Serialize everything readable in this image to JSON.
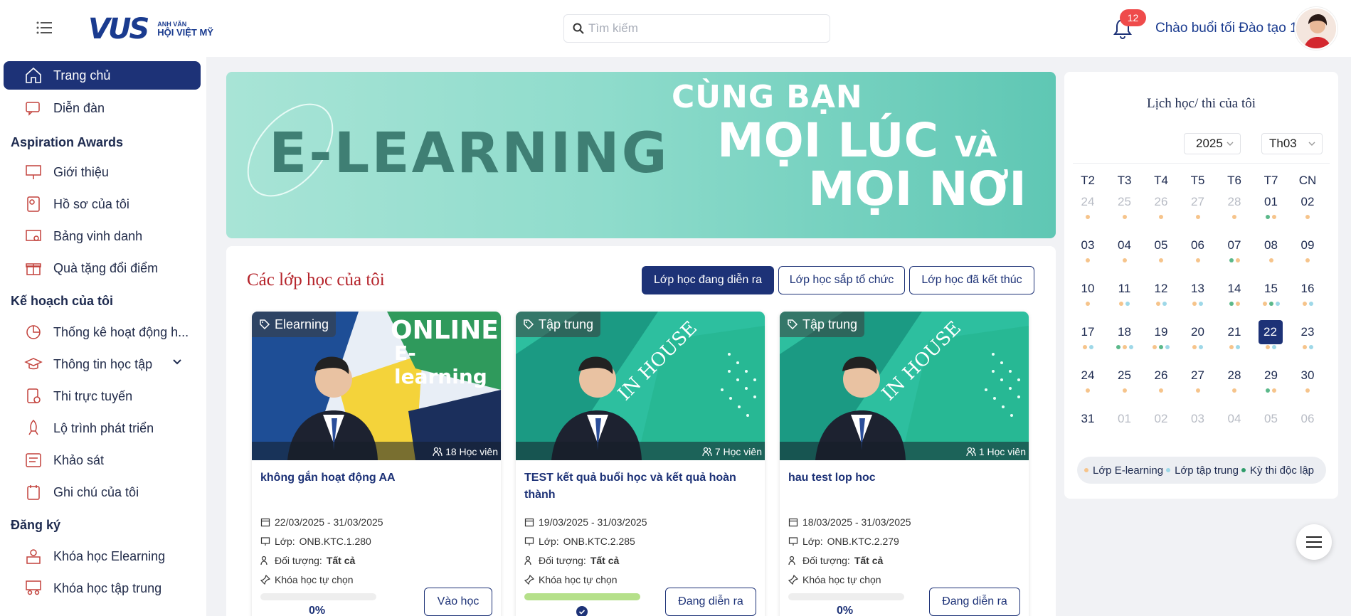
{
  "header": {
    "logo_mark": "VUS",
    "logo_sub": "ANH VĂN",
    "logo_main": "HỘI VIỆT MỸ",
    "search_placeholder": "Tìm kiếm",
    "notification_count": "12",
    "greeting": "Chào buổi tối Đào tạo 1"
  },
  "sidebar": {
    "items": [
      {
        "label": "Trang chủ",
        "icon": "home-icon"
      },
      {
        "label": "Diễn đàn",
        "icon": "forum-icon"
      },
      {
        "label": "Giới thiệu",
        "icon": "presentation-icon"
      },
      {
        "label": "Hồ sơ của tôi",
        "icon": "profile-icon"
      },
      {
        "label": "Bảng vinh danh",
        "icon": "certificate-icon"
      },
      {
        "label": "Quà tặng đổi điểm",
        "icon": "gift-icon"
      },
      {
        "label": "Thống kê hoạt động h...",
        "icon": "pie-chart-icon"
      },
      {
        "label": "Thông tin học tập",
        "icon": "graduation-cap-icon"
      },
      {
        "label": "Thi trực tuyến",
        "icon": "exam-icon"
      },
      {
        "label": "Lộ trình phát triển",
        "icon": "rocket-icon"
      },
      {
        "label": "Khảo sát",
        "icon": "survey-icon"
      },
      {
        "label": "Ghi chú của tôi",
        "icon": "note-icon"
      },
      {
        "label": "Khóa học Elearning",
        "icon": "elearning-icon"
      },
      {
        "label": "Khóa học tập trung",
        "icon": "classroom-icon"
      }
    ],
    "sections": [
      "Aspiration Awards",
      "Kế hoạch của tôi",
      "Đăng ký"
    ]
  },
  "banner": {
    "line1": "E-LEARNING",
    "line2": "CÙNG BẠN",
    "line3a": "MỌI LÚC",
    "line3b": "VÀ",
    "line4": "MỌI NƠI"
  },
  "classes": {
    "title": "Các lớp học của tôi",
    "tabs": [
      "Lớp học đang diễn ra",
      "Lớp học sắp tổ chức",
      "Lớp học đã kết thúc"
    ],
    "cards": [
      {
        "tag": "Elearning",
        "students": "18 Học viên",
        "img_text1": "ONLINE",
        "img_text2": "E-learning",
        "title": "không gắn hoạt động AA",
        "date": "22/03/2025 - 31/03/2025",
        "class_label": "Lớp:",
        "class_code": "ONB.KTC.1.280",
        "audience_label": "Đối tượng:",
        "audience": "Tất cả",
        "type": "Khóa học tự chọn",
        "progress": 0,
        "progress_label": "0%",
        "button": "Vào học"
      },
      {
        "tag": "Tập trung",
        "students": "7 Học viên",
        "img_text1": "IN HOUSE",
        "title": "TEST kết quả buổi học và kết quả hoàn thành",
        "date": "19/03/2025 - 31/03/2025",
        "class_label": "Lớp:",
        "class_code": "ONB.KTC.2.285",
        "audience_label": "Đối tượng:",
        "audience": "Tất cả",
        "type": "Khóa học tự chọn",
        "progress": 100,
        "progress_label": "",
        "button": "Đang diễn ra"
      },
      {
        "tag": "Tập trung",
        "students": "1 Học viên",
        "img_text1": "IN HOUSE",
        "title": "hau test lop hoc",
        "date": "18/03/2025 - 31/03/2025",
        "class_label": "Lớp:",
        "class_code": "ONB.KTC.2.279",
        "audience_label": "Đối tượng:",
        "audience": "Tất cả",
        "type": "Khóa học tự chọn",
        "progress": 0,
        "progress_label": "0%",
        "button": "Đang diễn ra"
      }
    ]
  },
  "calendar": {
    "title": "Lịch học/ thi của tôi",
    "year": "2025",
    "month": "Th03",
    "weekdays": [
      "T2",
      "T3",
      "T4",
      "T5",
      "T6",
      "T7",
      "CN"
    ],
    "today": "22",
    "weeks": [
      [
        {
          "d": "24",
          "m": true,
          "dots": [
            "o"
          ]
        },
        {
          "d": "25",
          "m": true,
          "dots": [
            "o"
          ]
        },
        {
          "d": "26",
          "m": true,
          "dots": [
            "o"
          ]
        },
        {
          "d": "27",
          "m": true,
          "dots": [
            "o"
          ]
        },
        {
          "d": "28",
          "m": true,
          "dots": [
            "o"
          ]
        },
        {
          "d": "01",
          "dots": [
            "g",
            "o"
          ]
        },
        {
          "d": "02",
          "dots": [
            "o"
          ]
        }
      ],
      [
        {
          "d": "03",
          "dots": [
            "o"
          ]
        },
        {
          "d": "04",
          "dots": [
            "o"
          ]
        },
        {
          "d": "05",
          "dots": [
            "o"
          ]
        },
        {
          "d": "06",
          "dots": [
            "o"
          ]
        },
        {
          "d": "07",
          "dots": [
            "g",
            "o"
          ]
        },
        {
          "d": "08",
          "dots": [
            "o"
          ]
        },
        {
          "d": "09",
          "dots": [
            "o"
          ]
        }
      ],
      [
        {
          "d": "10",
          "dots": [
            "o"
          ]
        },
        {
          "d": "11",
          "dots": [
            "o",
            "b"
          ]
        },
        {
          "d": "12",
          "dots": [
            "o",
            "b"
          ]
        },
        {
          "d": "13",
          "dots": [
            "o",
            "b"
          ]
        },
        {
          "d": "14",
          "dots": [
            "g",
            "o"
          ]
        },
        {
          "d": "15",
          "dots": [
            "o",
            "g",
            "b"
          ]
        },
        {
          "d": "16",
          "dots": [
            "o",
            "b"
          ]
        }
      ],
      [
        {
          "d": "17",
          "dots": [
            "o",
            "b"
          ]
        },
        {
          "d": "18",
          "dots": [
            "g",
            "o",
            "b"
          ]
        },
        {
          "d": "19",
          "dots": [
            "o",
            "g",
            "b"
          ]
        },
        {
          "d": "20",
          "dots": [
            "o",
            "b"
          ]
        },
        {
          "d": "21",
          "dots": [
            "o",
            "b"
          ]
        },
        {
          "d": "22",
          "today": true,
          "dots": [
            "o",
            "b"
          ]
        },
        {
          "d": "23",
          "dots": [
            "o",
            "b"
          ]
        }
      ],
      [
        {
          "d": "24",
          "dots": [
            "o"
          ]
        },
        {
          "d": "25",
          "dots": [
            "o"
          ]
        },
        {
          "d": "26",
          "dots": [
            "o"
          ]
        },
        {
          "d": "27",
          "dots": [
            "o"
          ]
        },
        {
          "d": "28",
          "dots": [
            "o"
          ]
        },
        {
          "d": "29",
          "dots": [
            "g",
            "o"
          ]
        },
        {
          "d": "30",
          "dots": [
            "o"
          ]
        }
      ],
      [
        {
          "d": "31",
          "dots": []
        },
        {
          "d": "01",
          "m": true,
          "dots": []
        },
        {
          "d": "02",
          "m": true,
          "dots": []
        },
        {
          "d": "03",
          "m": true,
          "dots": []
        },
        {
          "d": "04",
          "m": true,
          "dots": []
        },
        {
          "d": "05",
          "m": true,
          "dots": []
        },
        {
          "d": "06",
          "m": true,
          "dots": []
        }
      ]
    ],
    "legend": [
      {
        "label": "Lớp E-learning",
        "color": "#f6c48b"
      },
      {
        "label": "Lớp tập trung",
        "color": "#9ed8e8"
      },
      {
        "label": "Kỳ thi độc lập",
        "color": "#2e9c6a"
      }
    ],
    "dot_colors": {
      "o": "#f6c48b",
      "b": "#9ed8e8",
      "g": "#5bb88a"
    }
  },
  "colors": {
    "brand_navy": "#1d3277",
    "brand_red": "#b5232a",
    "notification": "#ef4b4b"
  }
}
